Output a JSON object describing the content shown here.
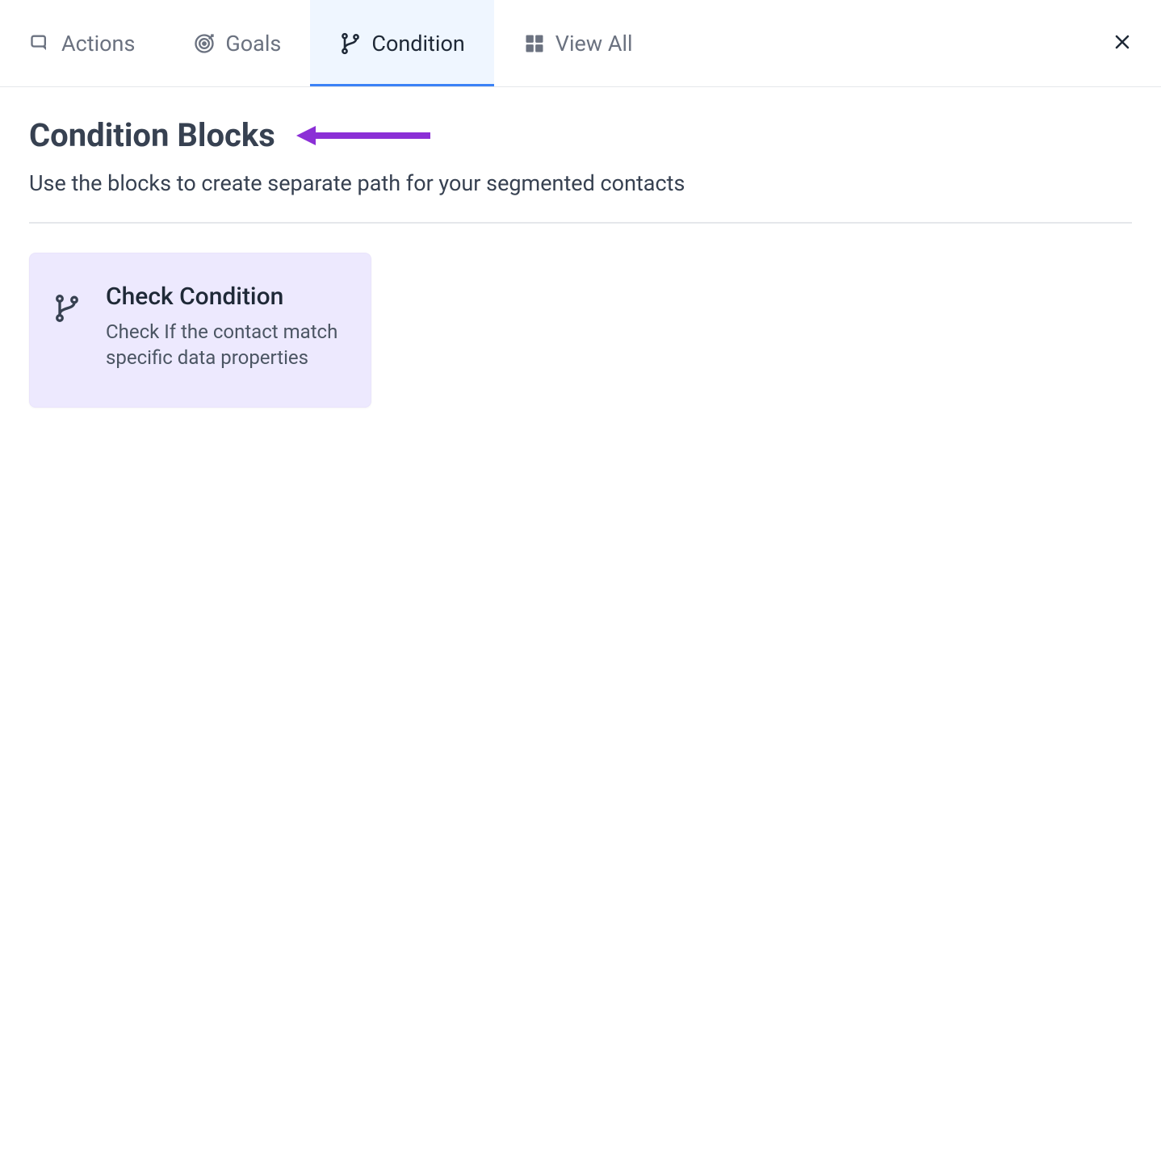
{
  "tabs": [
    {
      "label": "Actions",
      "icon": "action-icon",
      "active": false
    },
    {
      "label": "Goals",
      "icon": "goal-icon",
      "active": false
    },
    {
      "label": "Condition",
      "icon": "branch-icon",
      "active": true
    },
    {
      "label": "View All",
      "icon": "grid-icon",
      "active": false
    }
  ],
  "page": {
    "title": "Condition Blocks",
    "subtitle": "Use the blocks to create separate path for your segmented contacts"
  },
  "blocks": [
    {
      "title": "Check Condition",
      "description": "Check If the contact match specific data properties",
      "icon": "branch-icon"
    }
  ],
  "colors": {
    "accent": "#3b82f6",
    "arrow": "#8b2fd6",
    "card_bg": "#ede9fe"
  }
}
